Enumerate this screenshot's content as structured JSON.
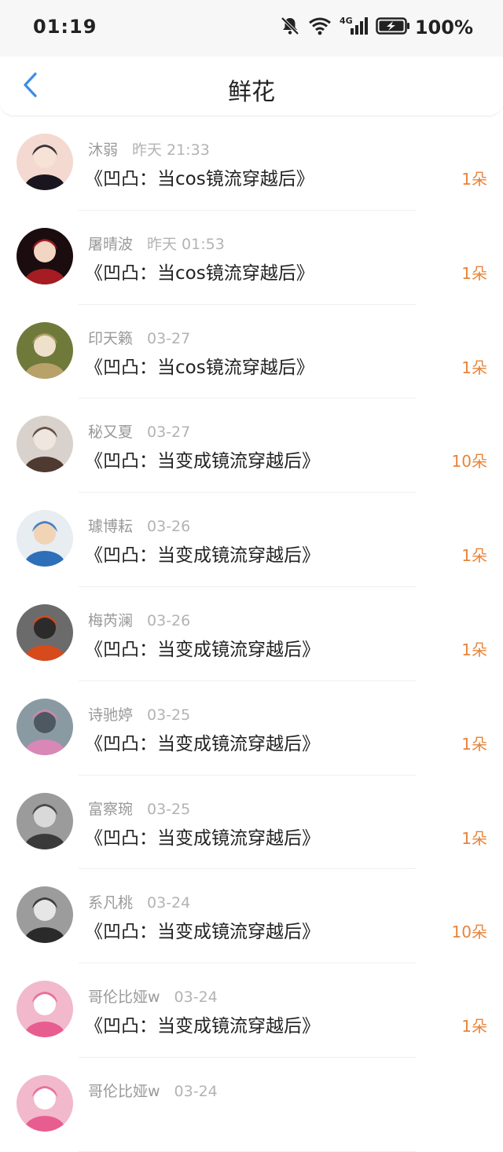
{
  "status_bar": {
    "time": "01:19",
    "network": "4G",
    "battery": "100%",
    "icons": [
      "mute-bell-icon",
      "wifi-icon",
      "signal-icon",
      "battery-charging-icon"
    ]
  },
  "header": {
    "title": "鲜花",
    "back_icon": "chevron-left-icon",
    "accent_color": "#3a8ee6"
  },
  "colors": {
    "count_color": "#e8843a",
    "meta_color": "#999999"
  },
  "list": [
    {
      "name": "沐弱",
      "date": "昨天 21:33",
      "book": "《凹凸：当cos镜流穿越后》",
      "count": "1朵",
      "avatar": [
        "#f3d9d0",
        "#1a1620",
        "#f6e2d6"
      ]
    },
    {
      "name": "屠晴波",
      "date": "昨天 01:53",
      "book": "《凹凸：当cos镜流穿越后》",
      "count": "1朵",
      "avatar": [
        "#1b0c10",
        "#a51c22",
        "#f3d5c4"
      ]
    },
    {
      "name": "印天籁",
      "date": "03-27",
      "book": "《凹凸：当cos镜流穿越后》",
      "count": "1朵",
      "avatar": [
        "#6f7a3a",
        "#b9a16a",
        "#efe0cc"
      ]
    },
    {
      "name": "秘又夏",
      "date": "03-27",
      "book": "《凹凸：当变成镜流穿越后》",
      "count": "10朵",
      "avatar": [
        "#d9d2cc",
        "#4e3a30",
        "#efe6df"
      ]
    },
    {
      "name": "璩博耘",
      "date": "03-26",
      "book": "《凹凸：当变成镜流穿越后》",
      "count": "1朵",
      "avatar": [
        "#e8edf2",
        "#2d6fb8",
        "#f1d3b5"
      ]
    },
    {
      "name": "梅芮澜",
      "date": "03-26",
      "book": "《凹凸：当变成镜流穿越后》",
      "count": "1朵",
      "avatar": [
        "#6b6b6b",
        "#d74a1c",
        "#2b2b2b"
      ]
    },
    {
      "name": "诗驰婷",
      "date": "03-25",
      "book": "《凹凸：当变成镜流穿越后》",
      "count": "1朵",
      "avatar": [
        "#8a9aa2",
        "#d887b6",
        "#4d5860"
      ]
    },
    {
      "name": "富察琬",
      "date": "03-25",
      "book": "《凹凸：当变成镜流穿越后》",
      "count": "1朵",
      "avatar": [
        "#9b9b9b",
        "#3a3a3a",
        "#d9d9d9"
      ]
    },
    {
      "name": "系凡桃",
      "date": "03-24",
      "book": "《凹凸：当变成镜流穿越后》",
      "count": "10朵",
      "avatar": [
        "#9c9c9c",
        "#2a2a2a",
        "#e6e6e6"
      ]
    },
    {
      "name": "哥伦比娅w",
      "date": "03-24",
      "book": "《凹凸：当变成镜流穿越后》",
      "count": "1朵",
      "avatar": [
        "#f2b8cc",
        "#e85d8f",
        "#ffffff"
      ]
    },
    {
      "name": "哥伦比娅w",
      "date": "03-24",
      "book": "",
      "count": "",
      "avatar": [
        "#f2b8cc",
        "#e85d8f",
        "#ffffff"
      ]
    }
  ]
}
